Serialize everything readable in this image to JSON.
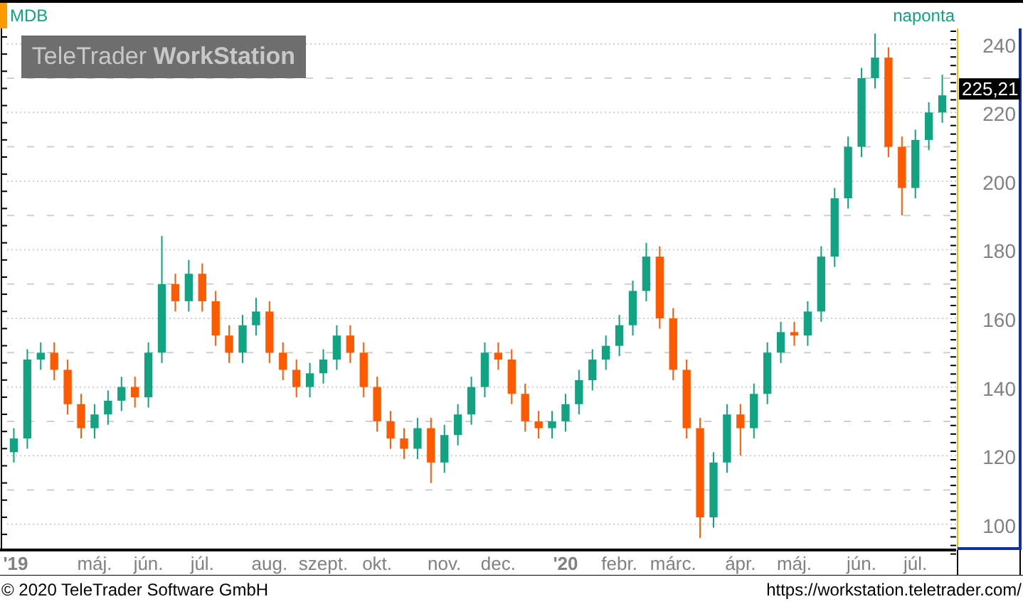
{
  "header": {
    "interval": "naponta"
  },
  "logo": "TeleTrader **WorkStation**",
  "last_price": "225,21",
  "chart_data": {
    "type": "candlestick",
    "grid": true,
    "categories": [
      "'19",
      null,
      null,
      null,
      null,
      null,
      "máj.",
      null,
      null,
      null,
      "jún.",
      null,
      null,
      null,
      "júl.",
      null,
      null,
      null,
      null,
      "aug.",
      null,
      null,
      null,
      "szept.",
      null,
      null,
      null,
      "okt.",
      null,
      null,
      null,
      null,
      "nov.",
      null,
      null,
      null,
      "dec.",
      null,
      null,
      null,
      null,
      "'20",
      null,
      null,
      null,
      "febr.",
      null,
      null,
      null,
      "márc.",
      null,
      null,
      null,
      null,
      "ápr.",
      null,
      null,
      null,
      "máj.",
      null,
      null,
      null,
      null,
      "jún.",
      null,
      null,
      null,
      "júl.",
      null,
      null
    ],
    "series": [
      {
        "name": "MDB",
        "ohlc": [
          [
            121,
            128,
            118,
            125
          ],
          [
            125,
            151,
            122,
            148
          ],
          [
            148,
            153,
            145,
            150
          ],
          [
            150,
            153,
            142,
            145
          ],
          [
            145,
            148,
            132,
            135
          ],
          [
            135,
            138,
            125,
            128
          ],
          [
            128,
            135,
            125,
            132
          ],
          [
            132,
            139,
            129,
            136
          ],
          [
            136,
            143,
            133,
            140
          ],
          [
            140,
            143,
            134,
            137
          ],
          [
            137,
            153,
            134,
            150
          ],
          [
            150,
            184,
            147,
            170
          ],
          [
            170,
            173,
            162,
            165
          ],
          [
            165,
            177,
            162,
            173
          ],
          [
            173,
            176,
            162,
            165
          ],
          [
            165,
            168,
            152,
            155
          ],
          [
            155,
            158,
            147,
            150
          ],
          [
            150,
            161,
            147,
            158
          ],
          [
            158,
            166,
            155,
            162
          ],
          [
            162,
            165,
            147,
            150
          ],
          [
            150,
            153,
            142,
            145
          ],
          [
            145,
            148,
            137,
            140
          ],
          [
            140,
            147,
            137,
            144
          ],
          [
            144,
            151,
            141,
            148
          ],
          [
            148,
            158,
            145,
            155
          ],
          [
            155,
            158,
            147,
            150
          ],
          [
            150,
            153,
            137,
            140
          ],
          [
            140,
            143,
            127,
            130
          ],
          [
            130,
            133,
            122,
            125
          ],
          [
            125,
            128,
            119,
            122
          ],
          [
            122,
            131,
            119,
            128
          ],
          [
            128,
            131,
            112,
            118
          ],
          [
            118,
            129,
            115,
            126
          ],
          [
            126,
            135,
            123,
            132
          ],
          [
            132,
            143,
            129,
            140
          ],
          [
            140,
            153,
            137,
            150
          ],
          [
            150,
            153,
            145,
            148
          ],
          [
            148,
            151,
            135,
            138
          ],
          [
            138,
            141,
            127,
            130
          ],
          [
            130,
            133,
            125,
            128
          ],
          [
            128,
            133,
            125,
            130
          ],
          [
            130,
            138,
            127,
            135
          ],
          [
            135,
            145,
            132,
            142
          ],
          [
            142,
            151,
            139,
            148
          ],
          [
            148,
            155,
            145,
            152
          ],
          [
            152,
            161,
            149,
            158
          ],
          [
            158,
            171,
            155,
            168
          ],
          [
            168,
            182,
            165,
            178
          ],
          [
            178,
            181,
            157,
            160
          ],
          [
            160,
            163,
            142,
            145
          ],
          [
            145,
            148,
            125,
            128
          ],
          [
            128,
            131,
            96,
            102
          ],
          [
            102,
            121,
            99,
            118
          ],
          [
            118,
            135,
            115,
            132
          ],
          [
            132,
            135,
            120,
            128
          ],
          [
            128,
            141,
            125,
            138
          ],
          [
            138,
            153,
            135,
            150
          ],
          [
            150,
            159,
            147,
            156
          ],
          [
            156,
            159,
            152,
            155
          ],
          [
            155,
            165,
            152,
            162
          ],
          [
            162,
            181,
            159,
            178
          ],
          [
            178,
            198,
            175,
            195
          ],
          [
            195,
            213,
            192,
            210
          ],
          [
            210,
            233,
            207,
            230
          ],
          [
            230,
            243,
            227,
            236
          ],
          [
            236,
            239,
            207,
            210
          ],
          [
            210,
            213,
            190,
            198
          ],
          [
            198,
            215,
            195,
            212
          ],
          [
            212,
            223,
            209,
            220
          ],
          [
            220,
            231,
            217,
            225
          ]
        ]
      }
    ],
    "ylim": [
      92.5,
      244.5
    ],
    "yticks": [
      100,
      120,
      140,
      160,
      180,
      200,
      220,
      240
    ]
  },
  "footer": {
    "copyright": "© 2020 TeleTrader Software GmbH",
    "url": "https://workstation.teletrader.com/"
  }
}
